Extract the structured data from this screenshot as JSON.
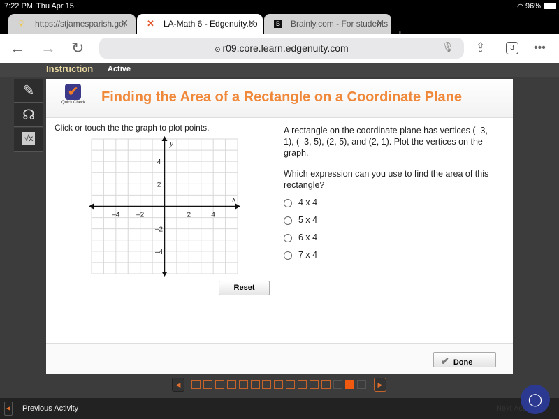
{
  "status": {
    "time": "7:22 PM",
    "date": "Thu Apr 15",
    "battery": "96%"
  },
  "browser": {
    "tabs": [
      {
        "label": "https://stjamesparish.ger",
        "icon": "lightbulb-icon"
      },
      {
        "label": "LA-Math 6 - Edgenuity.co",
        "icon": "edgenuity-icon",
        "active": true
      },
      {
        "label": "Brainly.com - For students",
        "icon": "brainly-icon"
      }
    ],
    "url": "r09.core.learn.edgenuity.com",
    "tab_count": "3"
  },
  "topbar": {
    "section": "Instruction",
    "status": "Active"
  },
  "card": {
    "badge": "Quick Check",
    "title": "Finding the Area of a Rectangle on a Coordinate Plane",
    "instruction": "Click or touch the the graph to plot points.",
    "question1": "A rectangle on the coordinate plane has vertices (–3, 1), (–3, 5), (2, 5), and (2, 1). Plot the vertices on the graph.",
    "question2": "Which expression can you use to find the area of this rectangle?",
    "options": [
      "4 x 4",
      "5 x 4",
      "6 x 4",
      "7 x 4"
    ],
    "reset": "Reset",
    "done": "Done"
  },
  "graph": {
    "xlabel": "x",
    "ylabel": "y",
    "xrange": [
      -6,
      6
    ],
    "yrange": [
      -6,
      6
    ],
    "xticks": [
      "–4",
      "–2",
      "2",
      "4"
    ],
    "yticks": [
      "4",
      "2",
      "–2",
      "–4"
    ]
  },
  "pager": {
    "completed": 12,
    "current": 13,
    "total": 15
  },
  "bottom": {
    "prev": "Previous Activity",
    "next": "Next Activity"
  },
  "colors": {
    "accent": "#f0883a",
    "current_page": "#f05a10",
    "chat": "#2c3990"
  }
}
